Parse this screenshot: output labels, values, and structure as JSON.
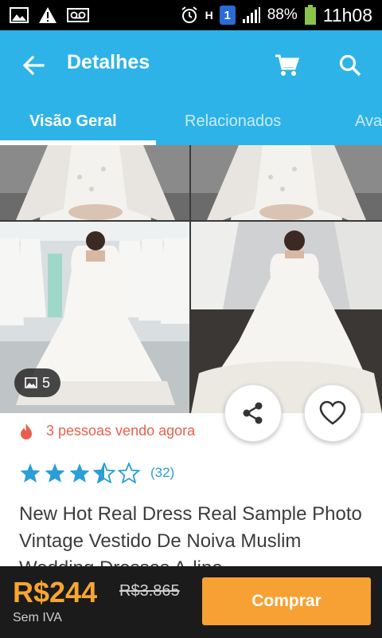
{
  "status_bar": {
    "battery_percent": "88%",
    "time": "11h08",
    "sim_label": "1",
    "network_label": "H",
    "icons": [
      "image-icon",
      "warning-icon",
      "voicemail-icon",
      "alarm-icon",
      "signal-icon",
      "battery-icon"
    ]
  },
  "header": {
    "title": "Detalhes",
    "bg_color": "#2db3e8",
    "icons": [
      "back-arrow-icon",
      "cart-icon",
      "search-icon"
    ]
  },
  "tabs": [
    {
      "label": "Visão Geral",
      "active": true
    },
    {
      "label": "Relacionados",
      "active": false
    },
    {
      "label": "Avaliações",
      "active": false
    }
  ],
  "gallery": {
    "photo_count": "5",
    "photos": [
      "wedding-dress-top-left",
      "wedding-dress-top-right",
      "wedding-dress-back-view",
      "wedding-dress-front-view"
    ]
  },
  "actions": {
    "icons": [
      "share-icon",
      "heart-icon"
    ]
  },
  "product": {
    "viewers_text": "3 pessoas vendo agora",
    "rating_value": 3.5,
    "rating_max": 5,
    "rating_count": "(32)",
    "title": "New Hot Real Dress Real Sample Photo Vintage Vestido De Noiva Muslim Wedding Dresses A-line"
  },
  "purchase": {
    "price": "R$244",
    "old_price": "R$3.865",
    "tax_note": "Sem IVA",
    "buy_label": "Comprar",
    "price_color": "#f7a531",
    "button_color": "#f7a033"
  }
}
